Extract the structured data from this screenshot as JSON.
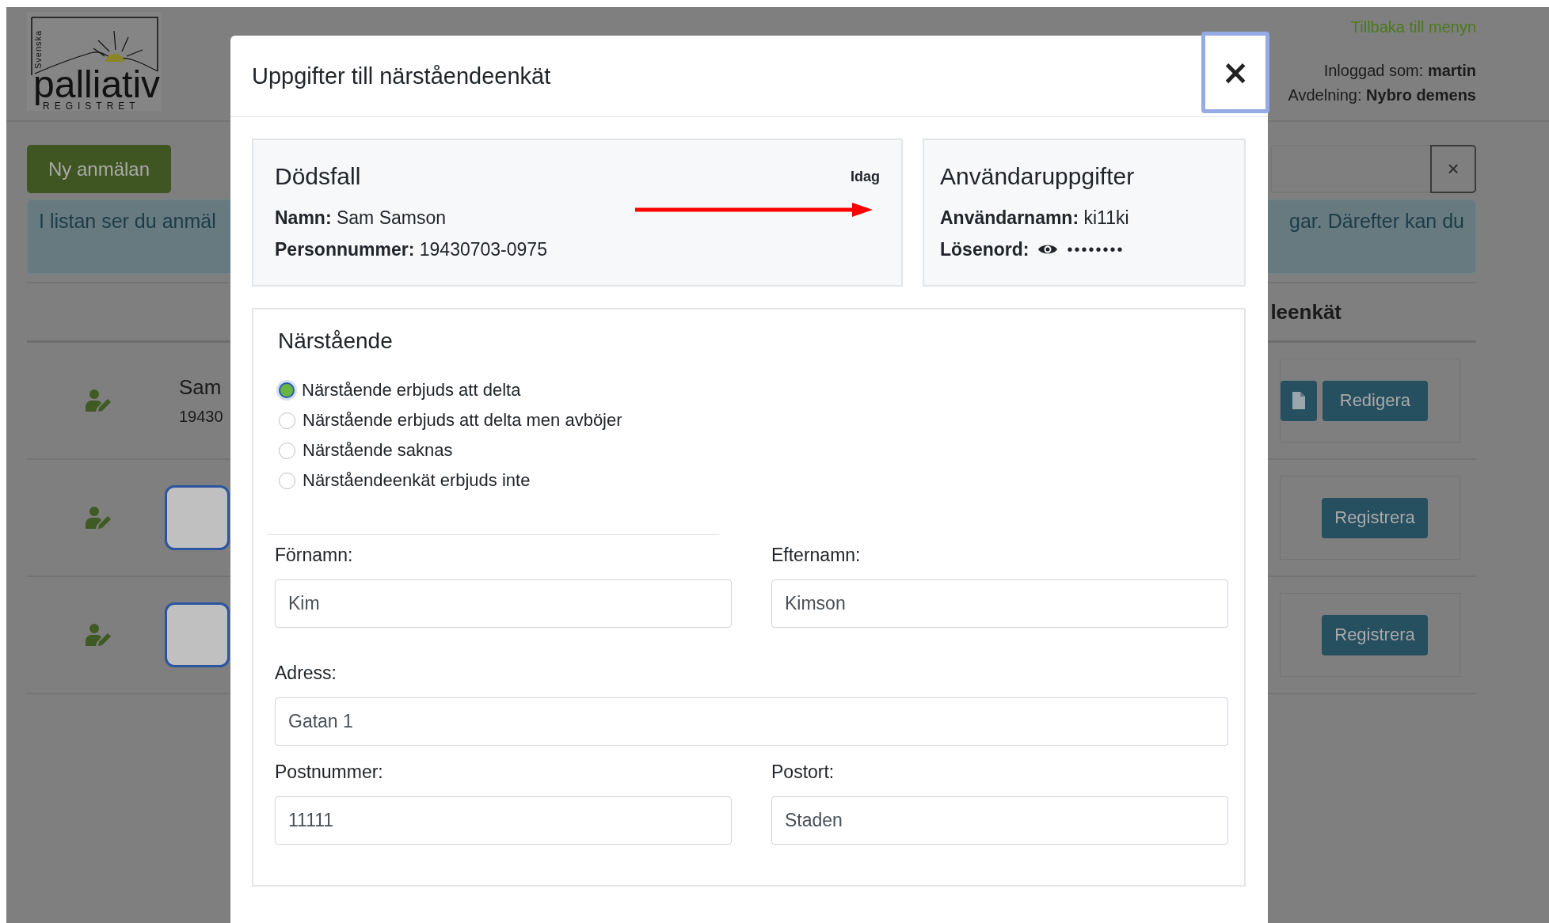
{
  "header": {
    "logo": {
      "side_text": "Svenska",
      "name": "palliativ",
      "sub": "REGISTRET"
    },
    "back_link": "Tillbaka till menyn",
    "user_label": "Inloggad som:",
    "user": "martin",
    "dept_label": "Avdelning:",
    "dept": "Nybro demens"
  },
  "toolbar": {
    "new_button": "Ny anmälan",
    "clear_button": "×"
  },
  "info": {
    "left": "I listan ser du anmäl",
    "right": "gar. Därefter kan du"
  },
  "list": {
    "heading": "leenkät",
    "rows": [
      {
        "kind": "person",
        "name": "Sam",
        "number": "19430",
        "buttons": [
          {
            "kind": "icon"
          },
          {
            "kind": "text",
            "label": "Redigera"
          }
        ]
      },
      {
        "kind": "picture",
        "buttons": [
          {
            "kind": "text",
            "label": "Registrera"
          }
        ]
      },
      {
        "kind": "picture",
        "buttons": [
          {
            "kind": "text",
            "label": "Registrera"
          }
        ]
      }
    ]
  },
  "modal": {
    "title": "Uppgifter till närståendeenkät",
    "close": "×",
    "death_card": {
      "title": "Dödsfall",
      "date": "Idag",
      "fields": [
        {
          "label": "Namn:",
          "value": "Sam Samson"
        },
        {
          "label": "Personnummer:",
          "value": "19430703-0975"
        }
      ]
    },
    "user_card": {
      "title": "Användaruppgifter",
      "username_label": "Användarnamn:",
      "username": "ki11ki",
      "password_label": "Lösenord:",
      "password": "••••••••"
    },
    "relative": {
      "title": "Närstående",
      "options": [
        {
          "label": "Närstående erbjuds att delta",
          "selected": true
        },
        {
          "label": "Närstående erbjuds att delta men avböjer",
          "selected": false
        },
        {
          "label": "Närstående saknas",
          "selected": false
        },
        {
          "label": "Närståendeenkät erbjuds inte",
          "selected": false
        }
      ],
      "field_rows": [
        {
          "fields": [
            {
              "label": "Förnamn:",
              "value": "Kim"
            },
            {
              "label": "Efternamn:",
              "value": "Kimson"
            }
          ]
        },
        {
          "fields": [
            {
              "label": "Adress:",
              "value": "Gatan 1"
            }
          ]
        },
        {
          "fields": [
            {
              "label": "Postnummer:",
              "value": "11111"
            },
            {
              "label": "Postort:",
              "value": "Staden"
            }
          ]
        }
      ]
    }
  }
}
